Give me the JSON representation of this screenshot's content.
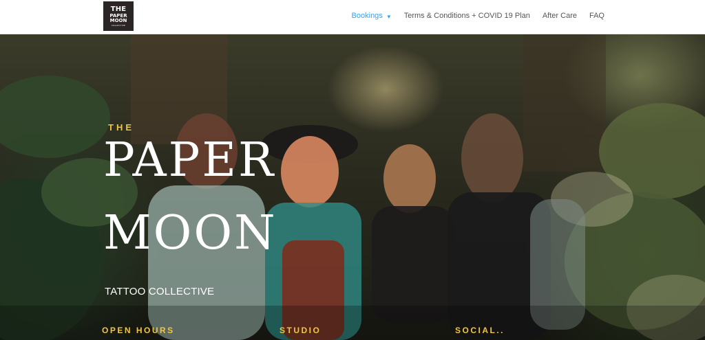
{
  "header": {
    "logo": {
      "line1": "THE",
      "line2": "PAPER",
      "line3": "MOON",
      "line4": "COLLECTIVE"
    },
    "nav": {
      "bookings": "Bookings",
      "terms": "Terms & Conditions + COVID 19 Plan",
      "aftercare": "After Care",
      "faq": "FAQ"
    }
  },
  "hero": {
    "the": "THE",
    "paper": "PAPER",
    "moon": "MOON",
    "subtitle": "TATTOO COLLECTIVE",
    "footer": {
      "open_hours": "OPEN HOURS",
      "studio": "STUDIO",
      "social": "SOCIAL.."
    }
  },
  "colors": {
    "accent": "#2ea3f2",
    "gold": "#f2c63a",
    "logo_bg": "#2b2625"
  },
  "icons": {
    "bookings_dropdown": "chevron-down-icon"
  }
}
